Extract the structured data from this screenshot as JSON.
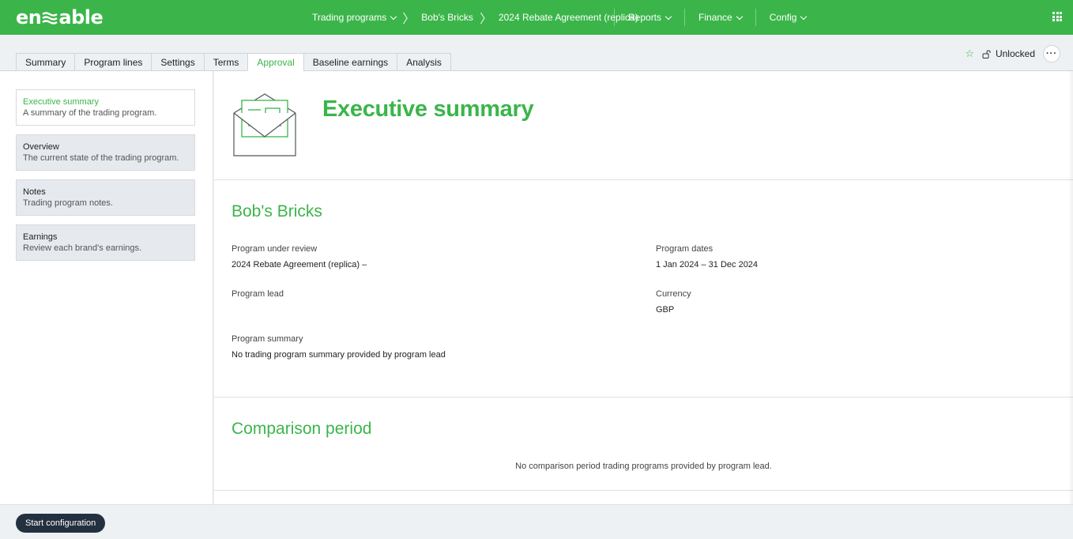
{
  "brand": {
    "logo_text_left": "en",
    "logo_text_right": "able",
    "accent_color": "#3bb54a",
    "dark_button_color": "#233040"
  },
  "breadcrumb": {
    "items": [
      "Trading programs",
      "Bob's Bricks",
      "2024 Rebate Agreement (replica)"
    ]
  },
  "nav": {
    "menus": [
      "Reports",
      "Finance",
      "Config"
    ]
  },
  "tabs": [
    "Summary",
    "Program lines",
    "Settings",
    "Terms",
    "Approval",
    "Baseline earnings",
    "Analysis"
  ],
  "active_tab": "Approval",
  "toolbar": {
    "lock_label": "Unlocked",
    "icons": [
      "star-icon",
      "unlock-icon",
      "more-icon",
      "apps-grid-icon"
    ]
  },
  "sidebar": {
    "items": [
      {
        "title": "Executive summary",
        "desc": "A summary of the trading program."
      },
      {
        "title": "Overview",
        "desc": "The current state of the trading program."
      },
      {
        "title": "Notes",
        "desc": "Trading program notes."
      },
      {
        "title": "Earnings",
        "desc": "Review each brand's earnings."
      }
    ]
  },
  "main": {
    "hero_title": "Executive summary",
    "company": "Bob's Bricks",
    "fields": {
      "program_under_review_label": "Program under review",
      "program_under_review_value": "2024 Rebate Agreement (replica) –",
      "program_dates_label": "Program dates",
      "program_dates_value": "1 Jan 2024 – 31 Dec 2024",
      "program_lead_label": "Program lead",
      "program_lead_value": "",
      "currency_label": "Currency",
      "currency_value": "GBP",
      "program_summary_label": "Program summary",
      "program_summary_value": "No trading program summary provided by program lead"
    },
    "comparison_title": "Comparison period",
    "comparison_empty": "No comparison period trading programs provided by program lead."
  },
  "footer": {
    "start_button": "Start configuration"
  }
}
